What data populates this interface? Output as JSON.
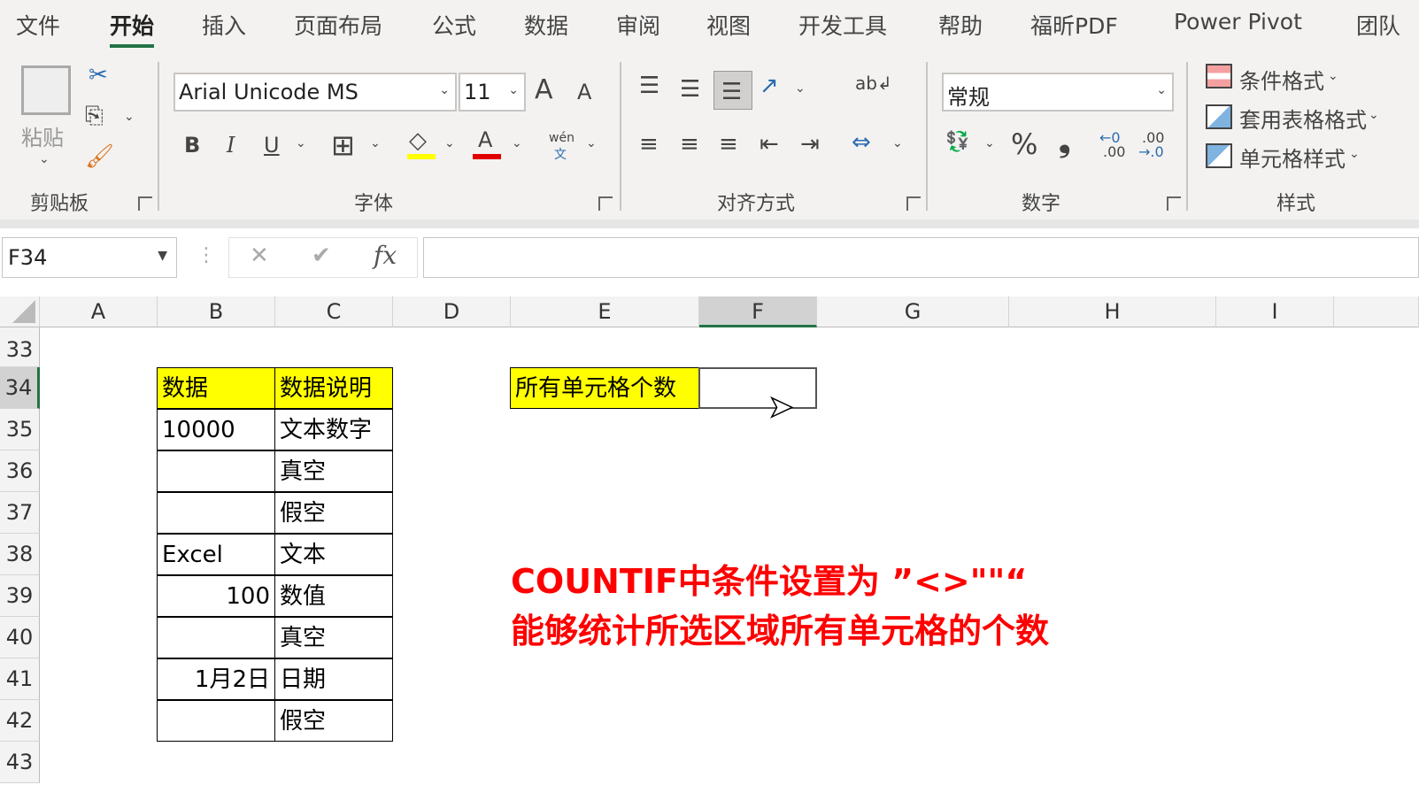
{
  "tabs": [
    "文件",
    "开始",
    "插入",
    "页面布局",
    "公式",
    "数据",
    "审阅",
    "视图",
    "开发工具",
    "帮助",
    "福昕PDF",
    "Power Pivot",
    "团队"
  ],
  "ribbon": {
    "clipboard": {
      "paste": "粘贴",
      "group": "剪贴板"
    },
    "font": {
      "name": "Arial Unicode MS",
      "size": "11",
      "bold": "B",
      "italic": "I",
      "underline": "U",
      "font_color": "A",
      "grow": "A",
      "shrink": "A",
      "phonetic_top": "wén",
      "phonetic_bottom": "文",
      "group": "字体",
      "fill_color": "#ffff00",
      "text_color": "#e00000"
    },
    "alignment": {
      "group": "对齐方式"
    },
    "number": {
      "format": "常规",
      "percent": "%",
      "comma": "❟",
      "inc_top": "←0",
      "inc_bottom": ".00",
      "dec_top": ".00",
      "dec_bottom": "→.0",
      "group": "数字"
    },
    "styles": {
      "conditional": "条件格式",
      "table": "套用表格格式",
      "cell": "单元格样式",
      "group": "样式"
    }
  },
  "formula_bar": {
    "name_box": "F34",
    "cancel": "✕",
    "enter": "✔",
    "fx": "fx",
    "value": ""
  },
  "columns": [
    "A",
    "B",
    "C",
    "D",
    "E",
    "F",
    "G",
    "H",
    "I"
  ],
  "rows": [
    "33",
    "34",
    "35",
    "36",
    "37",
    "38",
    "39",
    "40",
    "41",
    "42",
    "43"
  ],
  "table": {
    "headers": [
      "数据",
      "数据说明"
    ],
    "rows": [
      [
        "10000",
        "文本数字"
      ],
      [
        "",
        "真空"
      ],
      [
        "",
        "假空"
      ],
      [
        "Excel",
        "文本"
      ],
      [
        "100",
        "数值"
      ],
      [
        "",
        "真空"
      ],
      [
        "1月2日",
        "日期"
      ],
      [
        "",
        "假空"
      ]
    ]
  },
  "count_label": "所有单元格个数",
  "count_value": "",
  "note": [
    "COUNTIF中条件设置为 ”<>\"\"“",
    "能够统计所选区域所有单元格的个数"
  ]
}
